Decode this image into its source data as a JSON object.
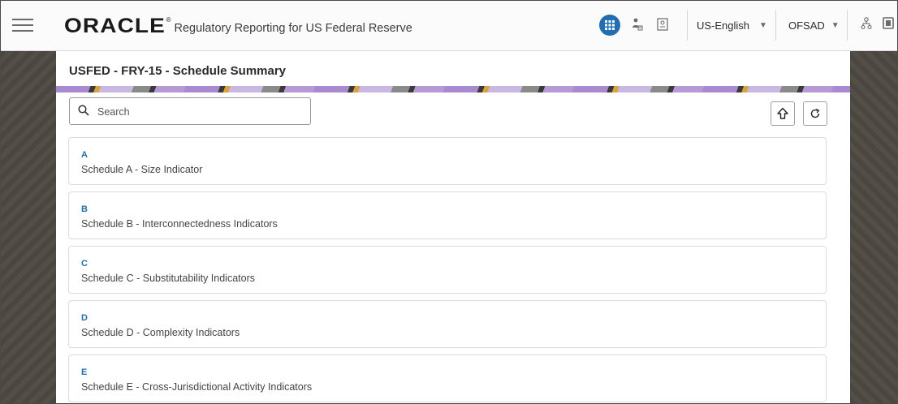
{
  "header": {
    "brand": "ORACLE",
    "reg_mark": "®",
    "app_title": "Regulatory Reporting for US Federal Reserve",
    "language": "US-English",
    "user": "OFSAD",
    "icons": [
      "menu-icon",
      "apps-grid-icon",
      "person-icon",
      "id-card-icon",
      "tree-icon",
      "document-icon"
    ]
  },
  "page": {
    "title": "USFED - FRY-15 - Schedule Summary"
  },
  "search": {
    "placeholder": "Search",
    "value": ""
  },
  "schedules": [
    {
      "code": "A",
      "label": "Schedule A - Size Indicator"
    },
    {
      "code": "B",
      "label": "Schedule B - Interconnectedness Indicators"
    },
    {
      "code": "C",
      "label": "Schedule C - Substitutability Indicators"
    },
    {
      "code": "D",
      "label": "Schedule D - Complexity Indicators"
    },
    {
      "code": "E",
      "label": "Schedule E - Cross-Jurisdictional Activity Indicators"
    }
  ],
  "colors": {
    "accent": "#1f6fb2",
    "header_bg": "#fbfbfb",
    "side_bg": "#4b463f"
  }
}
